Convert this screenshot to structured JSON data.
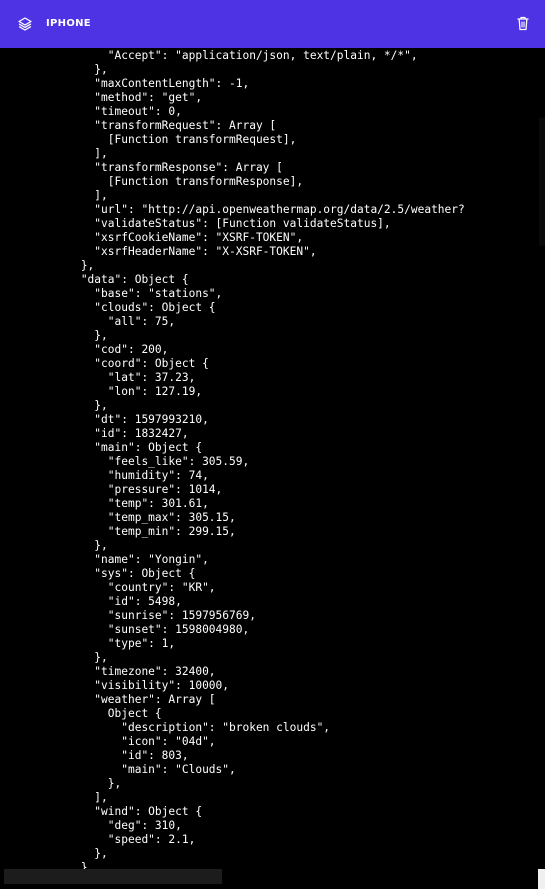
{
  "header": {
    "title": "IPHONE",
    "left_icon": "layers-icon",
    "right_icon": "trash-icon",
    "background": "#4d33e3"
  },
  "console": {
    "lines": [
      "                \"Accept\": \"application/json, text/plain, */*\",",
      "              },",
      "              \"maxContentLength\": -1,",
      "              \"method\": \"get\",",
      "              \"timeout\": 0,",
      "              \"transformRequest\": Array [",
      "                [Function transformRequest],",
      "              ],",
      "              \"transformResponse\": Array [",
      "                [Function transformResponse],",
      "              ],",
      "              \"url\": \"http://api.openweathermap.org/data/2.5/weather?",
      "              \"validateStatus\": [Function validateStatus],",
      "              \"xsrfCookieName\": \"XSRF-TOKEN\",",
      "              \"xsrfHeaderName\": \"X-XSRF-TOKEN\",",
      "            },",
      "            \"data\": Object {",
      "              \"base\": \"stations\",",
      "              \"clouds\": Object {",
      "                \"all\": 75,",
      "              },",
      "              \"cod\": 200,",
      "              \"coord\": Object {",
      "                \"lat\": 37.23,",
      "                \"lon\": 127.19,",
      "              },",
      "              \"dt\": 1597993210,",
      "              \"id\": 1832427,",
      "              \"main\": Object {",
      "                \"feels_like\": 305.59,",
      "                \"humidity\": 74,",
      "                \"pressure\": 1014,",
      "                \"temp\": 301.61,",
      "                \"temp_max\": 305.15,",
      "                \"temp_min\": 299.15,",
      "              },",
      "              \"name\": \"Yongin\",",
      "              \"sys\": Object {",
      "                \"country\": \"KR\",",
      "                \"id\": 5498,",
      "                \"sunrise\": 1597956769,",
      "                \"sunset\": 1598004980,",
      "                \"type\": 1,",
      "              },",
      "              \"timezone\": 32400,",
      "              \"visibility\": 10000,",
      "              \"weather\": Array [",
      "                Object {",
      "                  \"description\": \"broken clouds\",",
      "                  \"icon\": \"04d\",",
      "                  \"id\": 803,",
      "                  \"main\": \"Clouds\",",
      "                },",
      "              ],",
      "              \"wind\": Object {",
      "                \"deg\": 310,",
      "                \"speed\": 2.1,",
      "              },",
      "            },"
    ]
  }
}
